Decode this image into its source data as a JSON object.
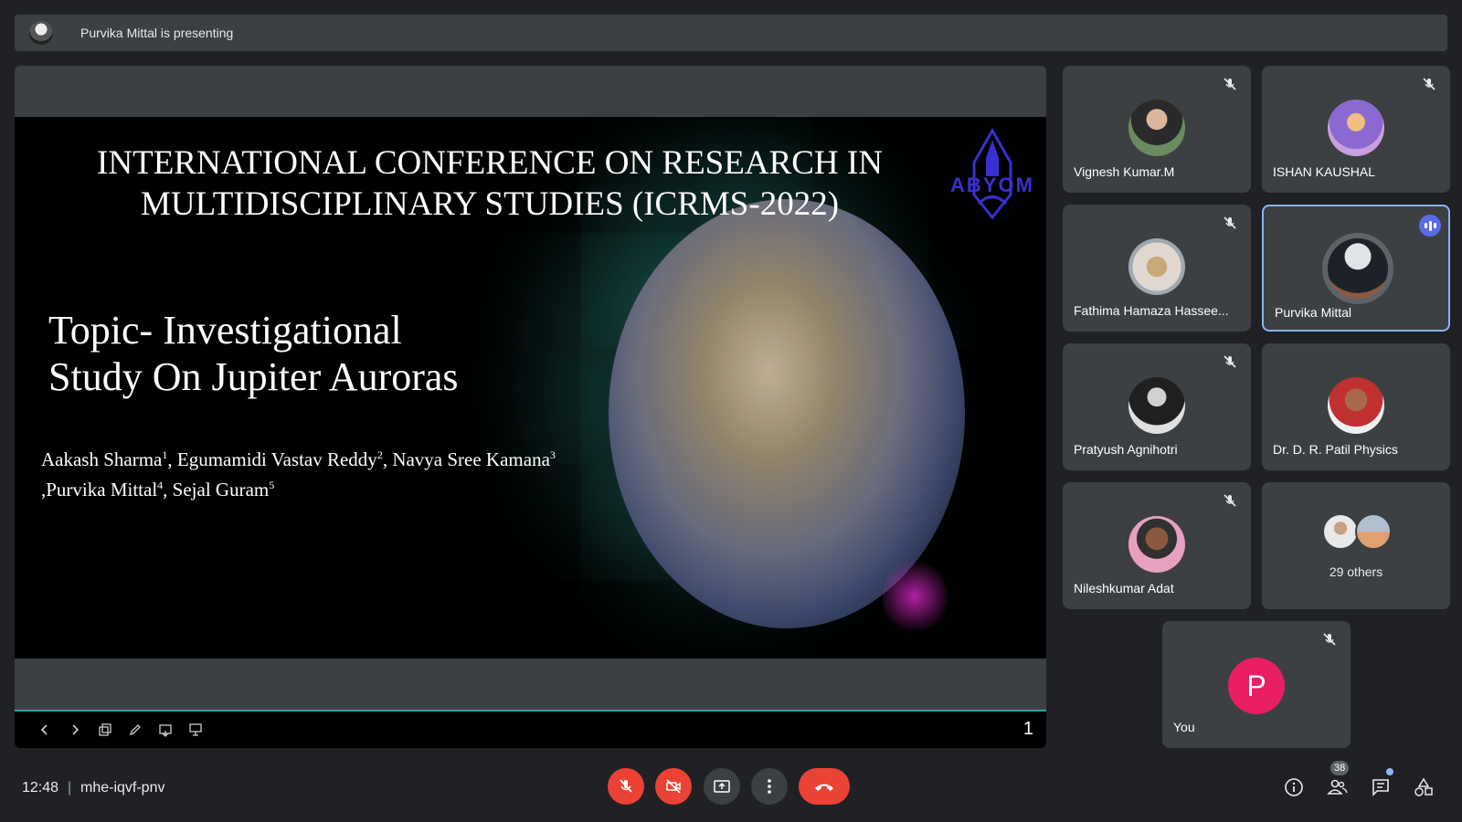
{
  "banner": {
    "text": "Purvika Mittal is presenting"
  },
  "slide": {
    "title_line1": "INTERNATIONAL CONFERENCE ON RESEARCH IN",
    "title_line2": "MULTIDISCIPLINARY STUDIES (ICRMS-2022)",
    "logo_text": "ABYOM",
    "topic_line1": "Topic- Investigational",
    "topic_line2": "Study On Jupiter Auroras",
    "authors": [
      {
        "name": "Aakash Sharma",
        "sup": "1"
      },
      {
        "name": ", Egumamidi Vastav Reddy",
        "sup": "2"
      },
      {
        "name": ", Navya Sree Kamana",
        "sup": "3"
      },
      {
        "name": ",Purvika Mittal",
        "sup": "4"
      },
      {
        "name": ", Sejal Guram",
        "sup": "5"
      }
    ],
    "page_number": "1"
  },
  "participants": [
    {
      "name": "Vignesh Kumar.M",
      "muted": true
    },
    {
      "name": "ISHAN KAUSHAL",
      "muted": true
    },
    {
      "name": "Fathima Hamaza Hassee...",
      "muted": true
    },
    {
      "name": "Purvika Mittal",
      "speaking": true
    },
    {
      "name": "Pratyush Agnihotri",
      "muted": true
    },
    {
      "name": "Dr. D. R. Patil Physics",
      "muted": false
    },
    {
      "name": "Nileshkumar Adat",
      "muted": true
    }
  ],
  "others": {
    "label": "29 others"
  },
  "self": {
    "name": "You",
    "initial": "P",
    "muted": true
  },
  "bottom": {
    "time": "12:48",
    "separator": "|",
    "meeting_code": "mhe-iqvf-pnv",
    "people_count": "38"
  },
  "colors": {
    "end_call": "#ea4335",
    "speaking_border": "#8ab4f8",
    "self_avatar": "#e91e63"
  }
}
